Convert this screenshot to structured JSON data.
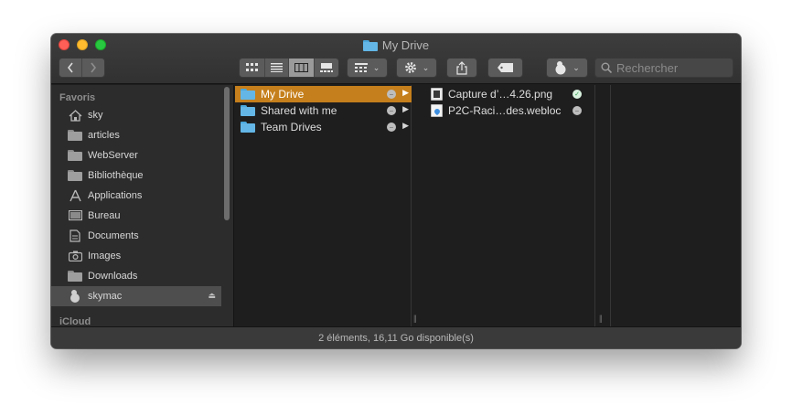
{
  "window": {
    "title": "My Drive"
  },
  "toolbar": {
    "back_icon": "chevron-left-icon",
    "forward_icon": "chevron-right-icon",
    "view_modes": [
      "icon-view",
      "list-view",
      "column-view",
      "gallery-view"
    ],
    "active_view": "column-view",
    "search_placeholder": "Rechercher"
  },
  "sidebar": {
    "favorites_header": "Favoris",
    "items": [
      {
        "label": "sky",
        "icon": "home-icon"
      },
      {
        "label": "articles",
        "icon": "folder-icon"
      },
      {
        "label": "WebServer",
        "icon": "folder-icon"
      },
      {
        "label": "Bibliothèque",
        "icon": "folder-icon"
      },
      {
        "label": "Applications",
        "icon": "applications-icon"
      },
      {
        "label": "Bureau",
        "icon": "desktop-icon"
      },
      {
        "label": "Documents",
        "icon": "documents-icon"
      },
      {
        "label": "Images",
        "icon": "camera-icon"
      },
      {
        "label": "Downloads",
        "icon": "folder-icon"
      },
      {
        "label": "skymac",
        "icon": "drive-icon",
        "selected": true
      }
    ],
    "icloud_header": "iCloud"
  },
  "columns": {
    "col1": [
      {
        "label": "My Drive",
        "selected": true,
        "status": "cloud",
        "has_children": true
      },
      {
        "label": "Shared with me",
        "selected": false,
        "status": "cloud",
        "has_children": true
      },
      {
        "label": "Team Drives",
        "selected": false,
        "status": "cloud",
        "has_children": true
      }
    ],
    "col2": [
      {
        "label": "Capture d’…4.26.png",
        "type": "png",
        "status": "synced"
      },
      {
        "label": "P2C-Raci…des.webloc",
        "type": "webloc",
        "status": "cloud"
      }
    ]
  },
  "statusbar": {
    "text": "2 éléments, 16,11 Go disponible(s)"
  },
  "colors": {
    "selection": "#c57f1c",
    "folder": "#63b6e6",
    "close": "#ff5f57",
    "minimize": "#febc2e",
    "maximize": "#28c840"
  }
}
